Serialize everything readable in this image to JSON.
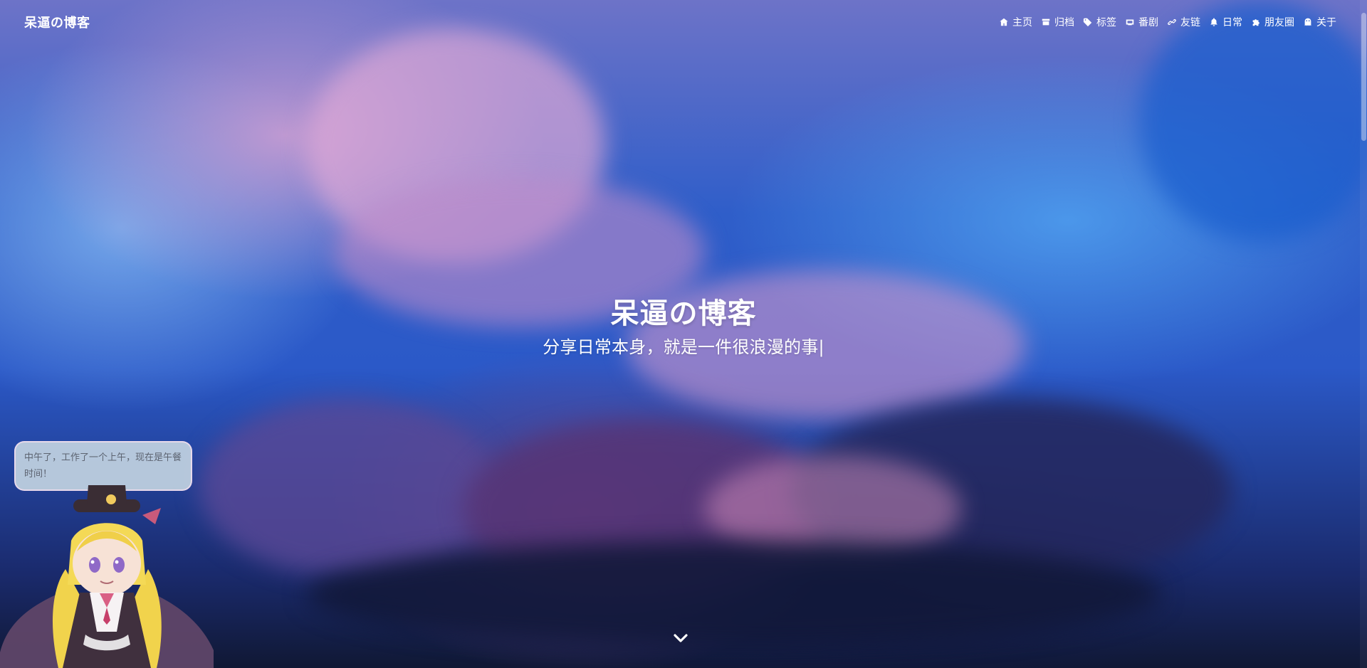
{
  "brand": {
    "title": "呆逼の博客"
  },
  "nav": {
    "items": [
      {
        "label": "主页",
        "icon": "home-icon"
      },
      {
        "label": "归档",
        "icon": "archive-icon"
      },
      {
        "label": "标签",
        "icon": "tags-icon"
      },
      {
        "label": "番剧",
        "icon": "anime-icon"
      },
      {
        "label": "友链",
        "icon": "link-icon"
      },
      {
        "label": "日常",
        "icon": "bell-icon"
      },
      {
        "label": "朋友圈",
        "icon": "puzzle-icon"
      },
      {
        "label": "关于",
        "icon": "ghost-icon"
      }
    ]
  },
  "hero": {
    "title": "呆逼の博客",
    "subtitle": "分享日常本身，就是一件很浪漫的事|"
  },
  "mascot": {
    "speech": "中午了，工作了一个上午，现在是午餐时间！"
  },
  "scroll": {
    "icon": "chevron-down-icon"
  }
}
